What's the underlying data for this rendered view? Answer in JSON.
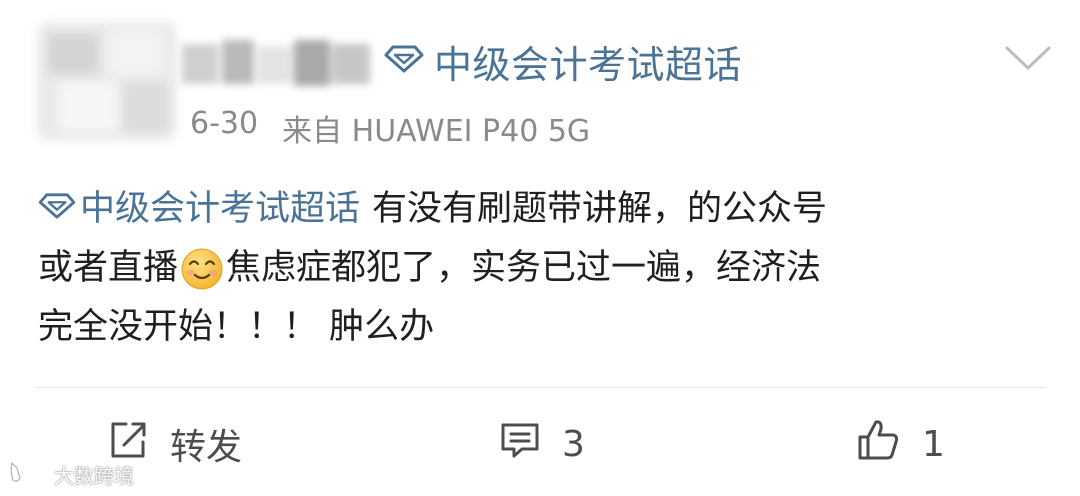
{
  "post": {
    "topic_header": "中级会计考试超话",
    "date": "6-30",
    "source": "来自 HUAWEI P40 5G",
    "inline_topic": "中级会计考试超话",
    "line1_text": "有没有刷题带讲解，的公众号",
    "line2_before_emoji": "或者直播",
    "line2_after_emoji": "焦虑症都犯了，实务已过一遍，经济法",
    "line3_text": "完全没开始！！！ 肿么办",
    "emoji": "smile-emoji"
  },
  "actions": {
    "share_label": "转发",
    "comment_count": "3",
    "like_count": "1"
  },
  "watermark": {
    "text": "大数跨境"
  },
  "colors": {
    "topic_blue": "#4a7396",
    "meta_gray": "#8a8a8a",
    "body_text": "#1f1f1f",
    "action_gray": "#4d4d4d"
  },
  "icons": {
    "topic": "diamond-icon",
    "menu": "chevron-down-icon",
    "share": "share-icon",
    "comment": "comment-icon",
    "like": "thumbs-up-icon"
  }
}
